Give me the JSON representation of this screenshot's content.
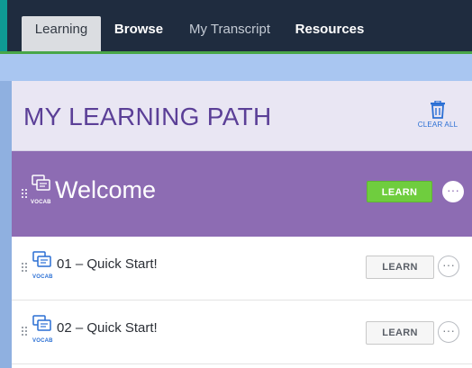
{
  "nav": {
    "tabs": [
      {
        "label": "Learning",
        "active": true
      },
      {
        "label": "Browse",
        "active": false
      },
      {
        "label": "My Transcript",
        "active": false
      },
      {
        "label": "Resources",
        "active": false
      }
    ]
  },
  "panel": {
    "title": "MY LEARNING PATH",
    "clear_all_label": "CLEAR ALL",
    "clear_all_icon": "trash-icon"
  },
  "path_items": [
    {
      "title": "Welcome",
      "type_label": "VOCAB",
      "button_label": "LEARN",
      "more_label": "···",
      "highlighted": true
    },
    {
      "title": "01 – Quick Start!",
      "type_label": "VOCAB",
      "button_label": "LEARN",
      "more_label": "···",
      "highlighted": false
    },
    {
      "title": "02 – Quick Start!",
      "type_label": "VOCAB",
      "button_label": "LEARN",
      "more_label": "···",
      "highlighted": false
    }
  ],
  "colors": {
    "nav_background": "#1f2c3f",
    "nav_accent": "#0f9a94",
    "active_tab": "#dbdde1",
    "page_background": "#a9c6f1",
    "panel_header": "#e9e6f3",
    "title_purple": "#5b3f97",
    "featured_row": "#8d6cb3",
    "learn_green": "#6fcd3e",
    "link_blue": "#2a6fd4"
  }
}
